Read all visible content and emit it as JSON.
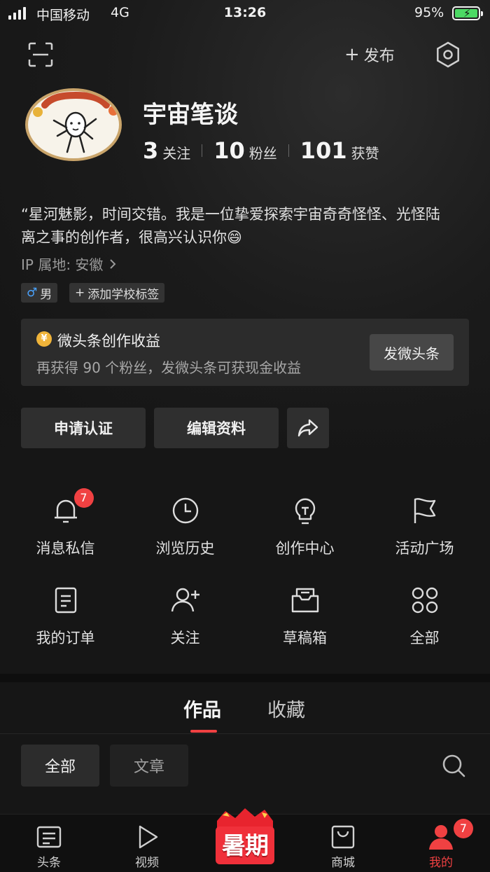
{
  "status_bar": {
    "carrier": "中国移动",
    "network": "4G",
    "time": "13:26",
    "battery": "95%"
  },
  "top_bar": {
    "publish_label": "发布"
  },
  "profile": {
    "name": "宇宙笔谈",
    "stats": [
      {
        "value": "3",
        "label": "关注"
      },
      {
        "value": "10",
        "label": "粉丝"
      },
      {
        "value": "101",
        "label": "获赞"
      }
    ],
    "bio_line1": "“星河魅影，时间交错。我是一位挚爱探索宇宙奇奇怪怪、光怪陆",
    "bio_line2": "离之事的创作者，很高兴认识你😄",
    "ip": "IP 属地: 安徽",
    "tags": {
      "gender": "男",
      "school": "添加学校标签"
    }
  },
  "income_card": {
    "title": "微头条创作收益",
    "desc": "再获得 90 个粉丝，发微头条可获现金收益",
    "button": "发微头条",
    "coin_symbol": "¥"
  },
  "actions": {
    "verify": "申请认证",
    "edit": "编辑资料"
  },
  "grid": [
    {
      "label": "消息私信",
      "icon": "bell-icon",
      "badge": "7"
    },
    {
      "label": "浏览历史",
      "icon": "clock-icon"
    },
    {
      "label": "创作中心",
      "icon": "lightbulb-icon"
    },
    {
      "label": "活动广场",
      "icon": "flag-icon"
    },
    {
      "label": "我的订单",
      "icon": "order-icon"
    },
    {
      "label": "关注",
      "icon": "add-user-icon"
    },
    {
      "label": "草稿箱",
      "icon": "drafts-icon"
    },
    {
      "label": "全部",
      "icon": "grid-icon"
    }
  ],
  "content_tabs": {
    "works": "作品",
    "favorites": "收藏"
  },
  "filters": {
    "all": "全部",
    "article": "文章"
  },
  "bottom_nav": [
    {
      "label": "头条",
      "icon": "news-icon"
    },
    {
      "label": "视频",
      "icon": "play-icon"
    },
    {
      "label": "商城",
      "icon": "shopping-bag-icon"
    },
    {
      "label": "我的",
      "icon": "user-icon",
      "badge": "7"
    }
  ],
  "promo": {
    "label": "暑期"
  },
  "colors": {
    "accent": "#f04142",
    "background": "#161616",
    "card": "#2c2c2c"
  }
}
